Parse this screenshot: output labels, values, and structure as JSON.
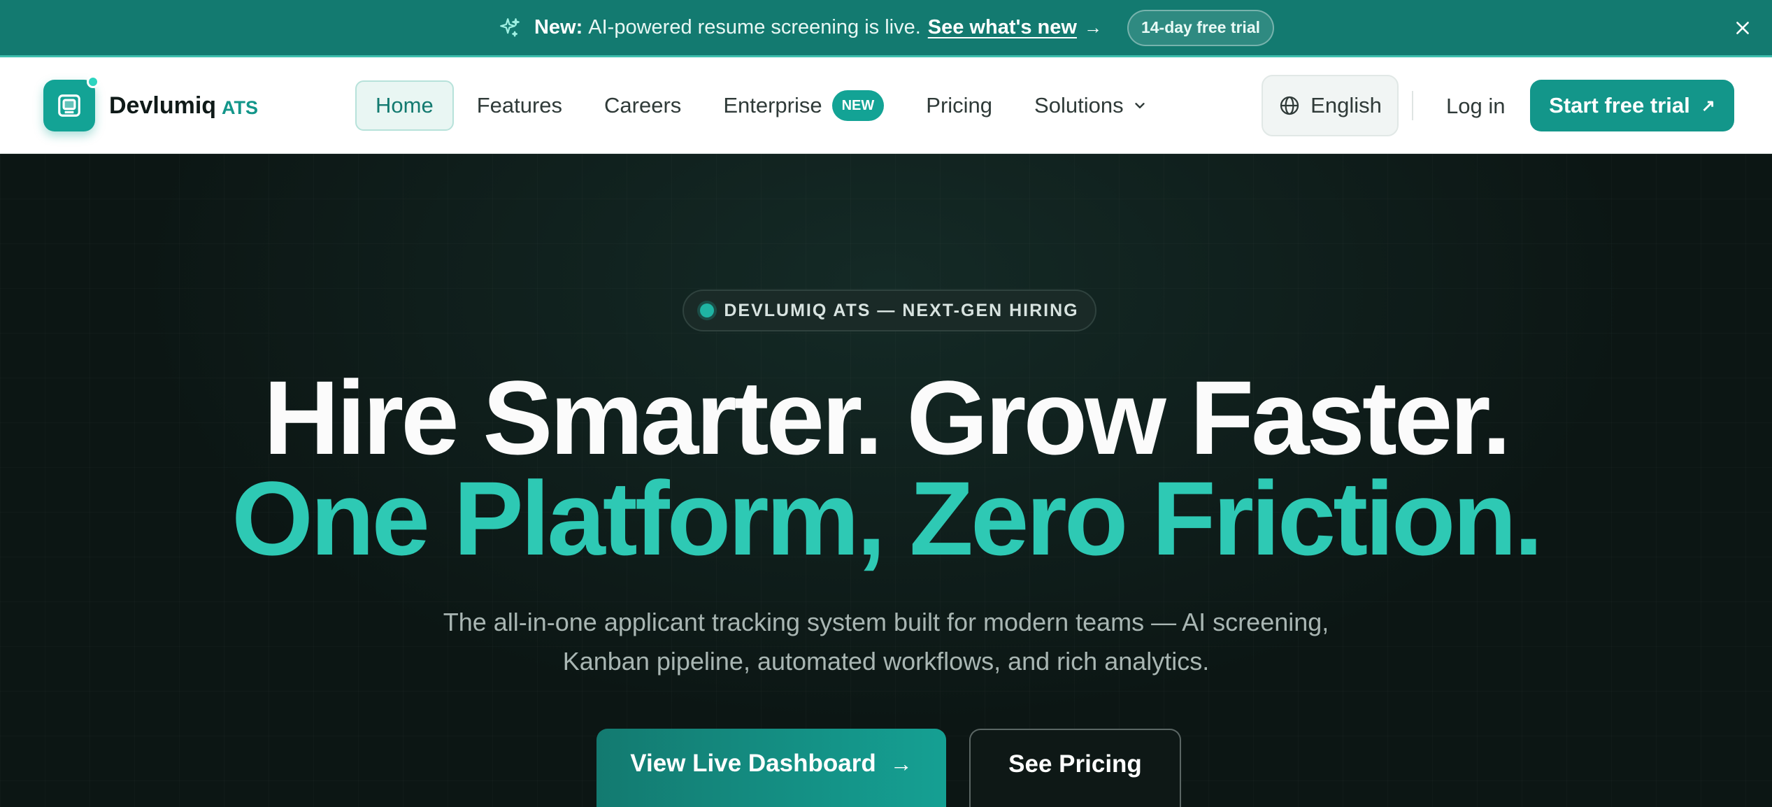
{
  "announcement": {
    "new_label": "New:",
    "message": "AI-powered resume screening is live.",
    "link_text": "See what's new",
    "arrow": "→",
    "trial_pill": "14-day free trial",
    "close": "✕",
    "bg_color": "#137a70"
  },
  "brand": {
    "name": "Devlumiq",
    "suffix": "ATS",
    "accent": "#13a395"
  },
  "nav": {
    "items": [
      {
        "label": "Home",
        "active": true
      },
      {
        "label": "Features"
      },
      {
        "label": "Careers"
      },
      {
        "label": "Enterprise",
        "badge": "NEW"
      },
      {
        "label": "Pricing"
      },
      {
        "label": "Solutions",
        "dropdown": true
      }
    ],
    "language": "English",
    "login": "Log in",
    "cta": "Start free trial",
    "cta_icon": "↗"
  },
  "hero": {
    "eyebrow": "DEVLUMIQ ATS — NEXT-GEN HIRING",
    "headline_line1": "Hire Smarter. Grow Faster.",
    "headline_line2": "One Platform, Zero Friction.",
    "subtitle": "The all-in-one applicant tracking system built for modern teams — AI screening, Kanban pipeline, automated workflows, and rich analytics.",
    "primary_button": "View Live Dashboard",
    "primary_arrow": "→",
    "secondary_button": "See Pricing",
    "headline_accent": "#2ec9b4"
  },
  "icons": {
    "announcement": "sparkle-icon",
    "close": "close-icon",
    "logo": "logo-icon",
    "dropdown": "chevron-down-icon",
    "language": "globe-icon",
    "external": "arrow-up-right-icon",
    "arrow": "arrow-right-icon"
  }
}
